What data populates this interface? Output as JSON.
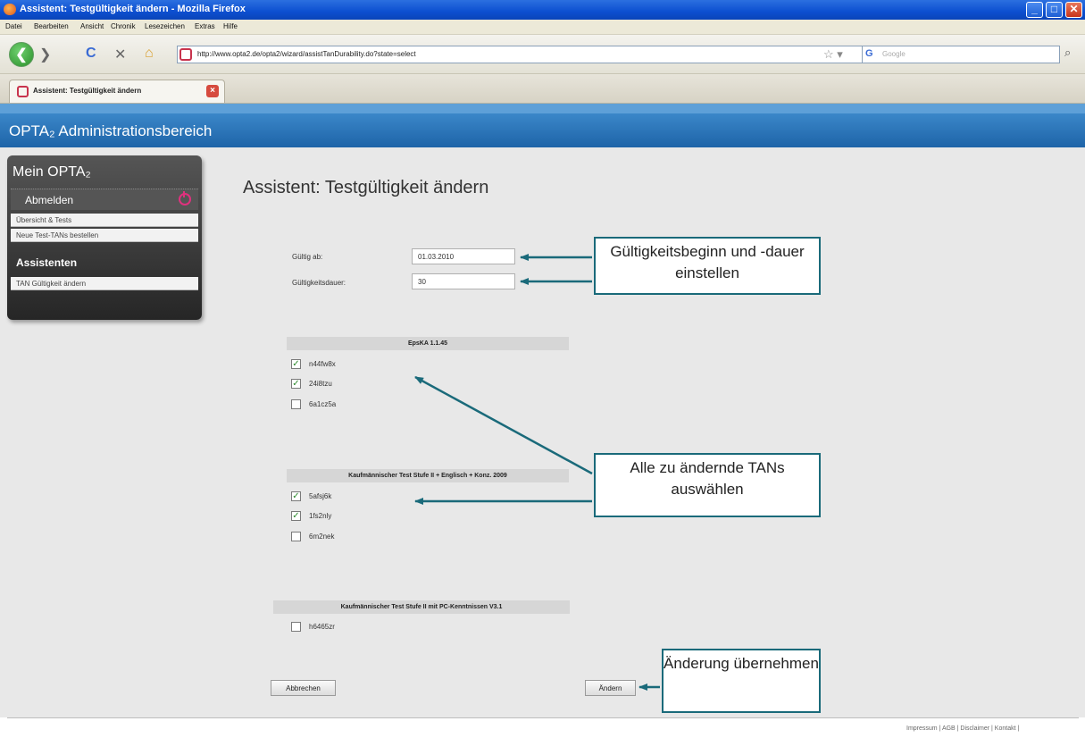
{
  "window": {
    "title": "Assistent: Testgültigkeit ändern - Mozilla Firefox",
    "minimize": "_",
    "maximize": "□",
    "close": "✕"
  },
  "menu": [
    "Datei",
    "Bearbeiten",
    "Ansicht",
    "Chronik",
    "Lesezeichen",
    "Extras",
    "Hilfe"
  ],
  "nav": {
    "url": "http://www.opta2.de/opta2/wizard/assistTanDurability.do?state=select",
    "search_placeholder": "Google",
    "search_engine": "G",
    "back_glyph": "❮",
    "forward_glyph": "❯",
    "reload_glyph": "C",
    "stop_glyph": "✕",
    "home_glyph": "⌂",
    "star_glyph": "☆ ▾",
    "search_glyph": "⌕"
  },
  "tab": {
    "label": "Assistent: Testgültigkeit ändern",
    "close": "×"
  },
  "header": {
    "title": "OPTA₂ Administrationsbereich"
  },
  "sidebar": {
    "title": "Mein OPTA₂",
    "logout": "Abmelden",
    "items": [
      "Übersicht & Tests",
      "Neue Test-TANs bestellen"
    ],
    "section": "Assistenten",
    "assistant_items": [
      "TAN Gültigkeit ändern"
    ]
  },
  "main": {
    "title": "Assistent: Testgültigkeit ändern",
    "form": {
      "valid_from_label": "Gültig ab:",
      "valid_from_value": "01.03.2010",
      "duration_label": "Gültigkeitsdauer:",
      "duration_value": "30"
    },
    "groups": [
      {
        "title": "EpsKA 1.1.45",
        "tans": [
          {
            "code": "n44fw8x",
            "checked": true
          },
          {
            "code": "24i8tzu",
            "checked": true
          },
          {
            "code": "6a1cz5a",
            "checked": false
          }
        ]
      },
      {
        "title": "Kaufmännischer Test Stufe II + Englisch + Konz. 2009",
        "tans": [
          {
            "code": "5afsj6k",
            "checked": true
          },
          {
            "code": "1fs2nly",
            "checked": true
          },
          {
            "code": "6m2nek",
            "checked": false
          }
        ]
      },
      {
        "title": "Kaufmännischer Test Stufe II mit PC-Kenntnissen V3.1",
        "tans": [
          {
            "code": "h6465zr",
            "checked": false
          }
        ]
      }
    ],
    "cancel_label": "Abbrechen",
    "submit_label": "Ändern"
  },
  "callouts": {
    "validity": "Gültigkeitsbeginn und -dauer einstellen",
    "select_tans": "Alle zu ändernde TANs auswählen",
    "apply": "Änderung übernehmen"
  },
  "footer": "Impressum | AGB | Disclaimer | Kontakt |",
  "colors": {
    "header_blue": "#2873b8",
    "callout_border": "#1a6a7a",
    "arrow": "#1a6a7a",
    "sidebar_dark": "#2f2f2f"
  }
}
